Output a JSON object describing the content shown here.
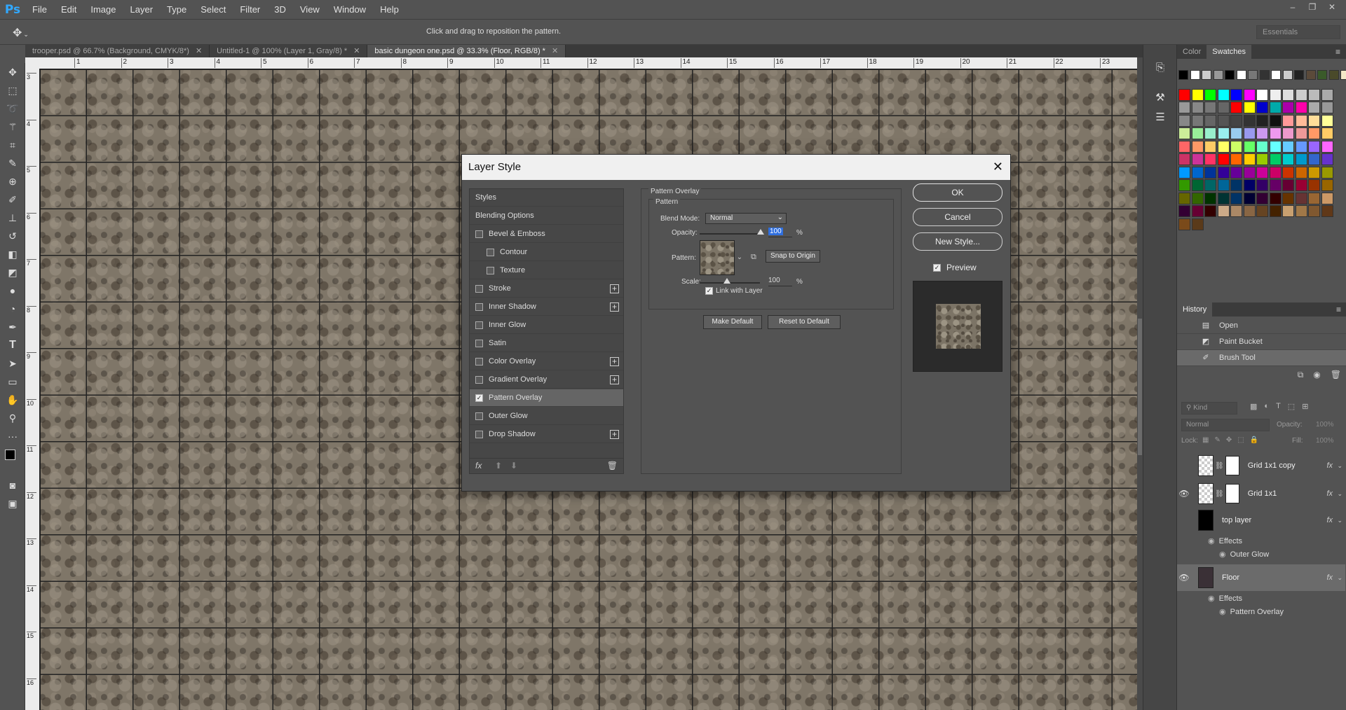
{
  "app": {
    "logo": "Ps",
    "menu": [
      "File",
      "Edit",
      "Image",
      "Layer",
      "Type",
      "Select",
      "Filter",
      "3D",
      "View",
      "Window",
      "Help"
    ],
    "window_controls": [
      "–",
      "❐",
      "✕"
    ]
  },
  "options": {
    "hint": "Click and drag to reposition the pattern.",
    "workspace": "Essentials"
  },
  "tabs": [
    {
      "label": "trooper.psd @ 66.7% (Background, CMYK/8*)",
      "active": false
    },
    {
      "label": "Untitled-1 @ 100% (Layer 1, Gray/8) *",
      "active": false
    },
    {
      "label": "basic dungeon one.psd @ 33.3% (Floor, RGB/8) *",
      "active": true
    }
  ],
  "rulers": {
    "h": [
      "1",
      "2",
      "3",
      "4",
      "5",
      "6",
      "7",
      "8",
      "9",
      "10",
      "11",
      "12",
      "13",
      "14",
      "15",
      "16",
      "17",
      "18",
      "19",
      "20",
      "21",
      "22",
      "23"
    ],
    "v": [
      "3",
      "4",
      "5",
      "6",
      "7",
      "8",
      "9",
      "10",
      "11",
      "12",
      "13",
      "14",
      "15",
      "16"
    ]
  },
  "panels": {
    "color_tab": "Color",
    "swatches_tab": "Swatches",
    "history_title": "History",
    "history": [
      {
        "label": "Open",
        "icon": "document-icon"
      },
      {
        "label": "Paint Bucket",
        "icon": "paint-bucket-icon"
      },
      {
        "label": "Brush Tool",
        "icon": "brush-icon",
        "selected": true
      }
    ],
    "layers_kind": "Kind",
    "layers_mode": "Normal",
    "layers_opacity_label": "Opacity:",
    "layers_opacity": "100%",
    "lock_label": "Lock:",
    "fill_label": "Fill:",
    "fill": "100%",
    "layers": [
      {
        "name": "Grid 1x1 copy",
        "fx": "fx",
        "visible": false
      },
      {
        "name": "Grid 1x1",
        "fx": "fx",
        "visible": true
      },
      {
        "name": "top layer",
        "fx": "fx",
        "visible": false,
        "effects": "Effects",
        "effect": "Outer Glow"
      },
      {
        "name": "Floor",
        "fx": "fx",
        "visible": true,
        "selected": true,
        "effects": "Effects",
        "effect": "Pattern Overlay"
      }
    ]
  },
  "dialog": {
    "title": "Layer Style",
    "styles": [
      {
        "label": "Styles",
        "cb": false,
        "plus": false,
        "indent": 0,
        "header": true
      },
      {
        "label": "Blending Options",
        "cb": false,
        "plus": false,
        "indent": 0,
        "header": true
      },
      {
        "label": "Bevel & Emboss",
        "cb": true,
        "checked": false,
        "plus": false,
        "indent": 0
      },
      {
        "label": "Contour",
        "cb": true,
        "checked": false,
        "plus": false,
        "indent": 1
      },
      {
        "label": "Texture",
        "cb": true,
        "checked": false,
        "plus": false,
        "indent": 1
      },
      {
        "label": "Stroke",
        "cb": true,
        "checked": false,
        "plus": true,
        "indent": 0
      },
      {
        "label": "Inner Shadow",
        "cb": true,
        "checked": false,
        "plus": true,
        "indent": 0
      },
      {
        "label": "Inner Glow",
        "cb": true,
        "checked": false,
        "plus": false,
        "indent": 0
      },
      {
        "label": "Satin",
        "cb": true,
        "checked": false,
        "plus": false,
        "indent": 0
      },
      {
        "label": "Color Overlay",
        "cb": true,
        "checked": false,
        "plus": true,
        "indent": 0
      },
      {
        "label": "Gradient Overlay",
        "cb": true,
        "checked": false,
        "plus": true,
        "indent": 0
      },
      {
        "label": "Pattern Overlay",
        "cb": true,
        "checked": true,
        "plus": false,
        "indent": 0,
        "selected": true
      },
      {
        "label": "Outer Glow",
        "cb": true,
        "checked": false,
        "plus": false,
        "indent": 0
      },
      {
        "label": "Drop Shadow",
        "cb": true,
        "checked": false,
        "plus": true,
        "indent": 0
      }
    ],
    "fx_label": "fx",
    "section_title": "Pattern Overlay",
    "group_title": "Pattern",
    "blend_label": "Blend Mode:",
    "blend_value": "Normal",
    "opacity_label": "Opacity:",
    "opacity_value": "100",
    "opacity_pct": "%",
    "pattern_label": "Pattern:",
    "snap_label": "Snap to Origin",
    "scale_label": "Scale:",
    "scale_value": "100",
    "scale_pct": "%",
    "link_label": "Link with Layer",
    "make_default": "Make Default",
    "reset_default": "Reset to Default",
    "ok": "OK",
    "cancel": "Cancel",
    "new_style": "New Style...",
    "preview": "Preview"
  },
  "swatch_colors": [
    [
      "#000000",
      "#ffffff",
      "#cccccc",
      "#999999",
      "#000000",
      "#ffffff",
      "#777777",
      "#333333",
      "#ffffff",
      "#cccccc",
      "#222222",
      "#5b4a3a",
      "#3a5a2a",
      "#4a4a2a",
      "#f4e8c8",
      "#8a6a3a"
    ],
    [
      "#ff0000",
      "#ffff00",
      "#00ff00",
      "#00ffff",
      "#0000ff",
      "#ff00ff",
      "#ffffff",
      "#eeeeee",
      "#dddddd",
      "#cccccc",
      "#bbbbbb",
      "#aaaaaa"
    ],
    [
      "#999999",
      "#888888",
      "#777777",
      "#666666",
      "#ff0000",
      "#ffff00",
      "#0000cc",
      "#00aaaa",
      "#aa00aa",
      "#ff00aa",
      "#aaaaaa",
      "#999999"
    ],
    [
      "#888888",
      "#777777",
      "#666666",
      "#555555",
      "#444444",
      "#333333",
      "#222222",
      "#111111",
      "#ff9999",
      "#ffbb99",
      "#ffdd99",
      "#ffff99"
    ],
    [
      "#ccee99",
      "#99ee99",
      "#99eecc",
      "#99eeee",
      "#99ccee",
      "#9999ee",
      "#cc99ee",
      "#ee99ee",
      "#ee99cc",
      "#ee9999",
      "#ff9966",
      "#ffcc66"
    ],
    [
      "#ff6666",
      "#ff9966",
      "#ffcc66",
      "#ffff66",
      "#ccff66",
      "#66ff66",
      "#66ffcc",
      "#66ffff",
      "#66ccff",
      "#6699ff",
      "#9966ff",
      "#ff66ff"
    ],
    [
      "#cc3366",
      "#cc3399",
      "#ff3366",
      "#ff0000",
      "#ff6600",
      "#ffcc00",
      "#99cc00",
      "#00cc66",
      "#00cccc",
      "#0099cc",
      "#3366cc",
      "#6633cc"
    ],
    [
      "#0099ff",
      "#0066cc",
      "#003399",
      "#330099",
      "#660099",
      "#990099",
      "#cc0099",
      "#cc0066",
      "#cc3300",
      "#cc6600",
      "#cc9900",
      "#999900"
    ],
    [
      "#339900",
      "#006633",
      "#006666",
      "#006699",
      "#003366",
      "#000066",
      "#330066",
      "#660066",
      "#660033",
      "#990033",
      "#993300",
      "#996600"
    ],
    [
      "#666600",
      "#336600",
      "#003300",
      "#003333",
      "#003366",
      "#000033",
      "#330033",
      "#330000",
      "#663300",
      "#663333",
      "#996633",
      "#cc9966"
    ],
    [
      "#330033",
      "#660033",
      "#330000",
      "#ccaa88",
      "#aa8866",
      "#886644",
      "#664422",
      "#442200",
      "#c8a070",
      "#a07848",
      "#805830",
      "#603818"
    ],
    [
      "#7a4a1a",
      "#5a3a1a"
    ]
  ]
}
